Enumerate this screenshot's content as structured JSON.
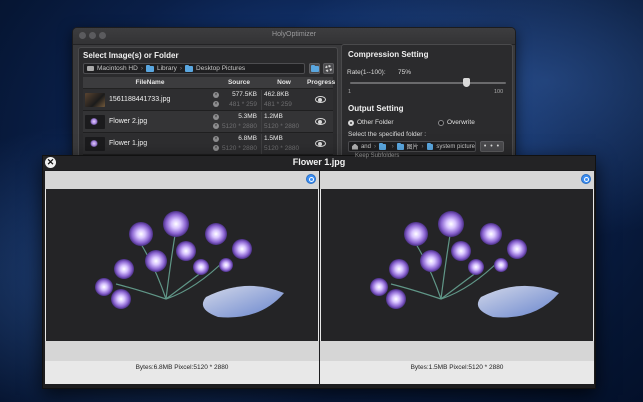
{
  "app": {
    "title": "HolyOptimizer"
  },
  "left_panel": {
    "heading": "Select Image(s) or Folder",
    "path": [
      "Macintosh HD",
      "Library",
      "Desktop Pictures"
    ]
  },
  "table": {
    "headers": {
      "name": "FileName",
      "source": "Source",
      "now": "Now",
      "progress": "Progress"
    },
    "rows": [
      {
        "name": "1561188441733.jpg",
        "source_size": "577.5KB",
        "source_dim": "481 * 259",
        "now_size": "462.8KB",
        "now_dim": "481 * 259"
      },
      {
        "name": "Flower 2.jpg",
        "source_size": "5.3MB",
        "source_dim": "5120 * 2880",
        "now_size": "1.2MB",
        "now_dim": "5120 * 2880"
      },
      {
        "name": "Flower 1.jpg",
        "source_size": "6.8MB",
        "source_dim": "5120 * 2880",
        "now_size": "1.5MB",
        "now_dim": "5120 * 2880"
      }
    ]
  },
  "compression": {
    "heading": "Compression Setting",
    "rate_label": "Rate(1--100):",
    "rate_value": "75%",
    "rate": 75,
    "min_label": "1",
    "max_label": "100"
  },
  "output": {
    "heading": "Output Setting",
    "option_other": "Other Folder",
    "option_overwrite": "Overwrite",
    "specify_label": "Select the specified folder :",
    "path": [
      "and",
      "",
      "图片",
      "system picture"
    ],
    "browse_label": "• • •",
    "keep_subfolders": "Keep Subfolders"
  },
  "preview": {
    "title": "Flower 1.jpg",
    "close_glyph": "✕",
    "left_caption": "Bytes:6.8MB  Pixcel:5120 * 2880",
    "right_caption": "Bytes:1.5MB  Pixcel:5120 * 2880"
  },
  "colors": {
    "accent": "#3c8ef2",
    "folder": "#5aa7e0"
  }
}
